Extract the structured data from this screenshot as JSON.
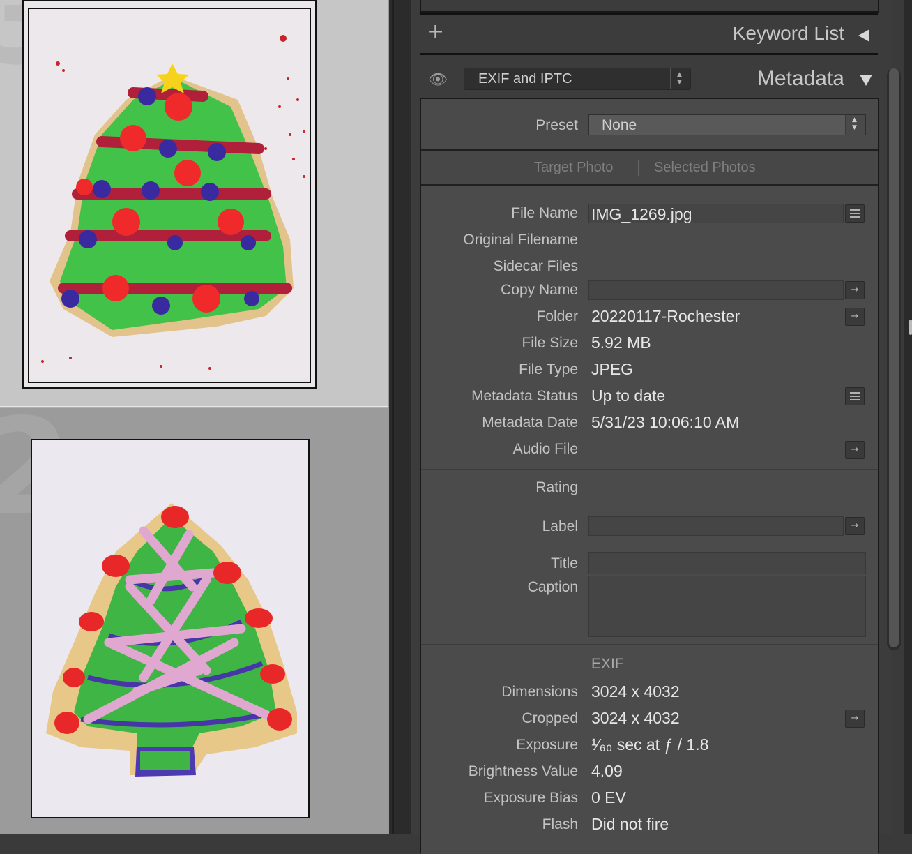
{
  "thumbnails": [
    {
      "index": "3",
      "description": "tree cookie 1"
    },
    {
      "index": "2",
      "description": "tree cookie 2"
    }
  ],
  "keyword_list": {
    "title": "Keyword List",
    "add_label": "+"
  },
  "metadata": {
    "title": "Metadata",
    "view_select": "EXIF and IPTC",
    "preset_label": "Preset",
    "preset_value": "None",
    "target_photo": "Target Photo",
    "selected_photos": "Selected Photos",
    "fields": {
      "file_name": {
        "label": "File Name",
        "value": "IMG_1269.jpg"
      },
      "original_filename": {
        "label": "Original Filename",
        "value": ""
      },
      "sidecar_files": {
        "label": "Sidecar Files",
        "value": ""
      },
      "copy_name": {
        "label": "Copy Name",
        "value": ""
      },
      "folder": {
        "label": "Folder",
        "value": "20220117-Rochester"
      },
      "file_size": {
        "label": "File Size",
        "value": "5.92 MB"
      },
      "file_type": {
        "label": "File Type",
        "value": "JPEG"
      },
      "metadata_status": {
        "label": "Metadata Status",
        "value": "Up to date"
      },
      "metadata_date": {
        "label": "Metadata Date",
        "value": "5/31/23 10:06:10 AM"
      },
      "audio_file": {
        "label": "Audio File",
        "value": ""
      },
      "rating": {
        "label": "Rating",
        "value": ""
      },
      "label": {
        "label": "Label",
        "value": ""
      },
      "title": {
        "label": "Title",
        "value": ""
      },
      "caption": {
        "label": "Caption",
        "value": ""
      }
    },
    "exif": {
      "section_label": "EXIF",
      "dimensions": {
        "label": "Dimensions",
        "value": "3024 x 4032"
      },
      "cropped": {
        "label": "Cropped",
        "value": "3024 x 4032"
      },
      "exposure": {
        "label": "Exposure",
        "value": "¹⁄₆₀ sec at ƒ / 1.8"
      },
      "brightness_value": {
        "label": "Brightness Value",
        "value": "4.09"
      },
      "exposure_bias": {
        "label": "Exposure Bias",
        "value": "0 EV"
      },
      "flash": {
        "label": "Flash",
        "value": "Did not fire"
      }
    }
  }
}
